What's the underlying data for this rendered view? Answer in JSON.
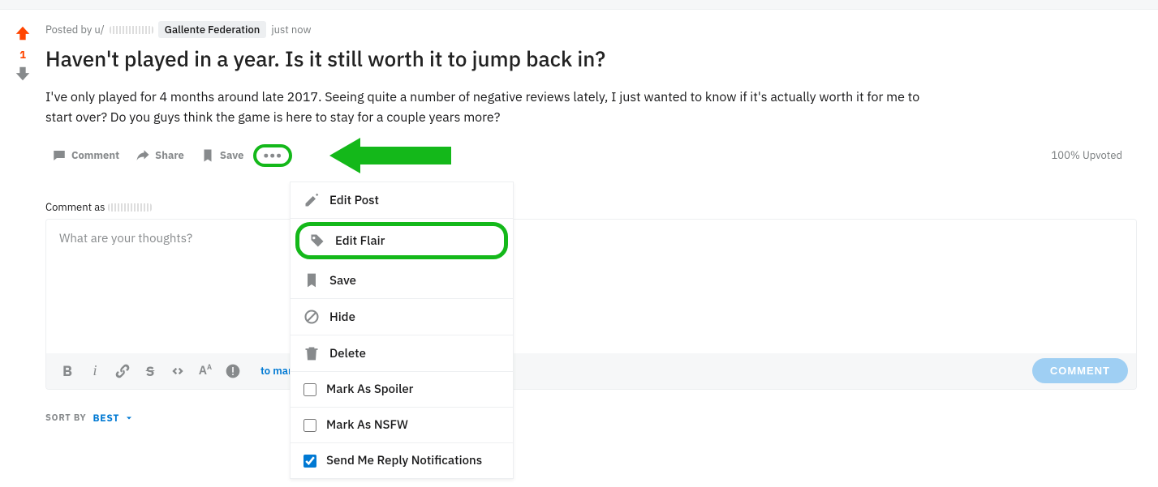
{
  "meta": {
    "posted_by_prefix": "Posted by u/",
    "flair": "Gallente Federation",
    "timestamp": "just now"
  },
  "post": {
    "title": "Haven't played in a year. Is it still worth it to jump back in?",
    "body": "I've only played for 4 months around late 2017. Seeing quite a number of negative reviews lately, I just wanted to know if it's actually worth it for me to start over? Do you guys think the game is here to stay for a couple years more?"
  },
  "vote": {
    "score": "1"
  },
  "actions": {
    "comment": "Comment",
    "share": "Share",
    "save": "Save",
    "upvoted": "100% Upvoted"
  },
  "dropdown": {
    "edit_post": "Edit Post",
    "edit_flair": "Edit Flair",
    "save": "Save",
    "hide": "Hide",
    "delete": "Delete",
    "mark_spoiler": "Mark As Spoiler",
    "mark_nsfw": "Mark As NSFW",
    "reply_notifications": "Send Me Reply Notifications",
    "spoiler_checked": false,
    "nsfw_checked": false,
    "notifications_checked": true
  },
  "comment": {
    "label_prefix": "Comment as ",
    "placeholder": "What are your thoughts?",
    "markdown_link": "to markdown",
    "submit": "COMMENT"
  },
  "sort": {
    "label": "SORT BY",
    "value": "BEST"
  }
}
